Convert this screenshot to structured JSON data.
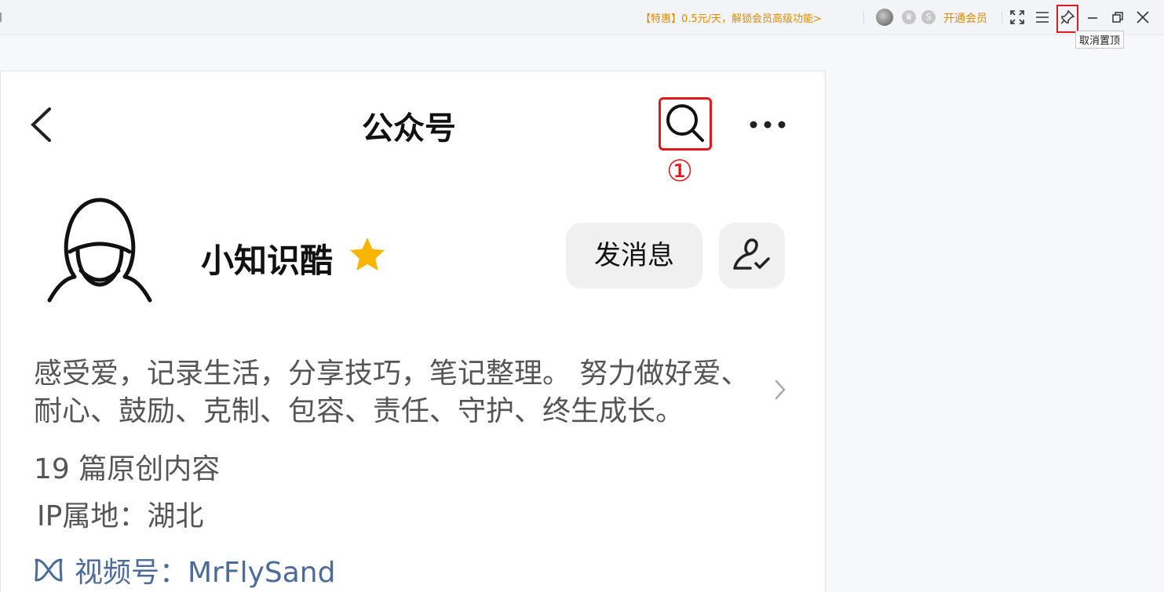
{
  "titlebar": {
    "promo": "【特惠】0.5元/天，解锁会员高级功能>",
    "vip_link": "开通会员",
    "pin_tooltip": "取消置顶"
  },
  "article": {
    "header_title": "公众号",
    "annotation": "①",
    "account_name": "小知识酷",
    "message_button": "发消息",
    "description": "感受爱，记录生活，分享技巧，笔记整理。 努力做好爱、耐心、鼓励、克制、包容、责任、守护、终生成长。",
    "original_count": "19 篇原创内容",
    "ip_location": "IP属地：湖北",
    "video_channel": "视频号：MrFlySand"
  },
  "colors": {
    "accent_orange": "#e08a00",
    "highlight_red": "#e0191f",
    "link_blue": "#4c6b9a",
    "star_gold": "#f7b500"
  }
}
